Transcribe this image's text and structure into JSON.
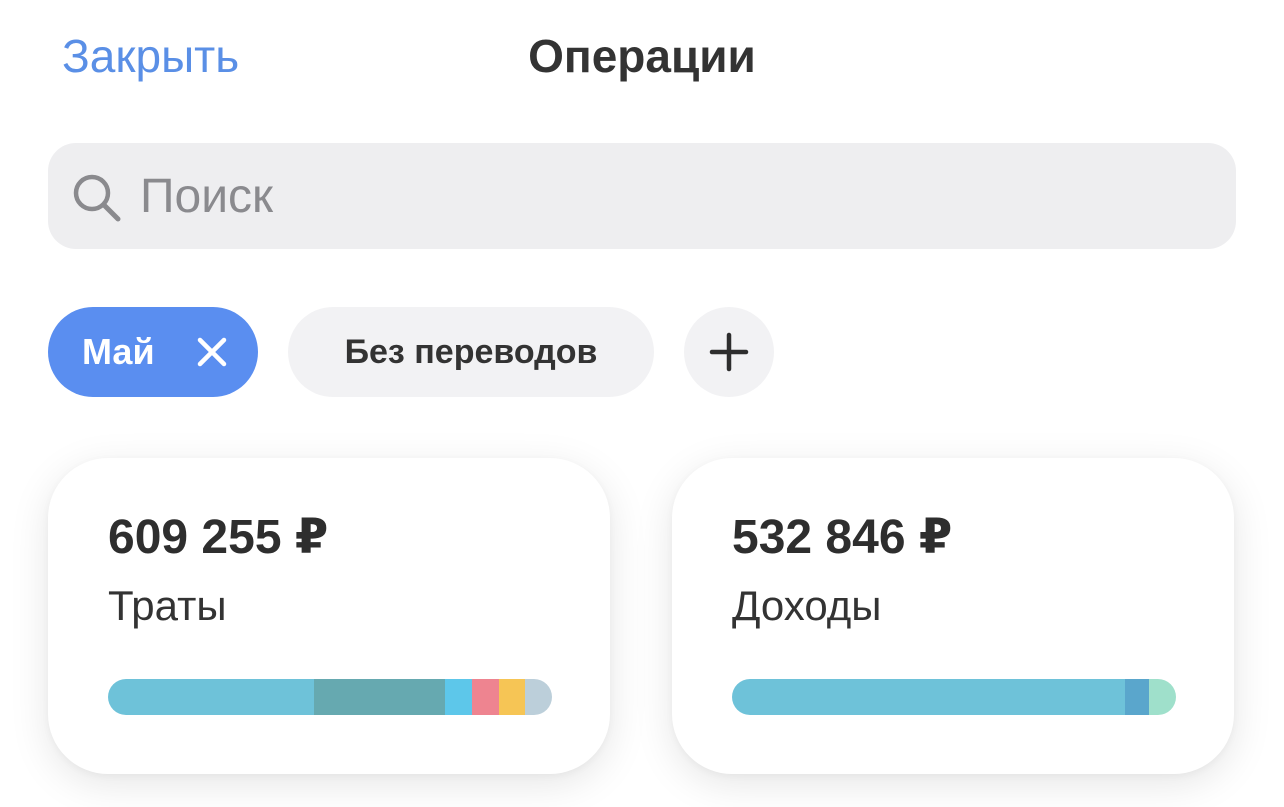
{
  "header": {
    "close_label": "Закрыть",
    "title": "Операции"
  },
  "search": {
    "placeholder": "Поиск",
    "icon": "search-icon"
  },
  "filters": {
    "month_chip": {
      "label": "Май",
      "icon": "close-icon",
      "active": true,
      "color": "#5a8ef0"
    },
    "transfers_chip": {
      "label": "Без переводов"
    },
    "add_chip": {
      "icon": "plus-icon"
    }
  },
  "cards": {
    "expenses": {
      "amount": "609 255 ₽",
      "label": "Траты",
      "segments": [
        {
          "share": 0.465,
          "color": "#6ec2d9"
        },
        {
          "share": 0.295,
          "color": "#66a9b0"
        },
        {
          "share": 0.06,
          "color": "#5dc7ea"
        },
        {
          "share": 0.06,
          "color": "#ee8490"
        },
        {
          "share": 0.06,
          "color": "#f6c555"
        },
        {
          "share": 0.06,
          "color": "#bccfda"
        }
      ]
    },
    "income": {
      "amount": "532 846 ₽",
      "label": "Доходы",
      "segments": [
        {
          "share": 0.885,
          "color": "#6ec2d9"
        },
        {
          "share": 0.055,
          "color": "#5aa6cc"
        },
        {
          "share": 0.06,
          "color": "#9fe0cb"
        }
      ]
    }
  }
}
